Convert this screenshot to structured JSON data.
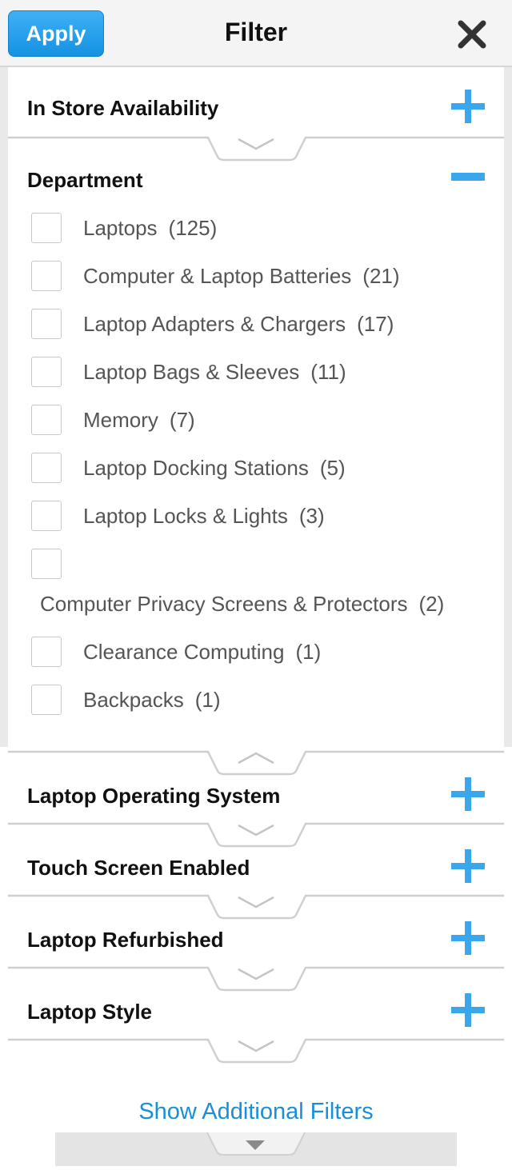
{
  "header": {
    "apply_label": "Apply",
    "title": "Filter"
  },
  "sections": {
    "in_store": "In Store Availability",
    "department": "Department",
    "os": "Laptop Operating System",
    "touch": "Touch Screen Enabled",
    "refurb": "Laptop Refurbished",
    "style": "Laptop Style"
  },
  "department_items": [
    {
      "label": "Laptops",
      "count": "(125)"
    },
    {
      "label": "Computer & Laptop Batteries",
      "count": "(21)"
    },
    {
      "label": "Laptop Adapters & Chargers",
      "count": "(17)"
    },
    {
      "label": "Laptop Bags & Sleeves",
      "count": "(11)"
    },
    {
      "label": "Memory",
      "count": "(7)"
    },
    {
      "label": "Laptop Docking Stations",
      "count": "(5)"
    },
    {
      "label": "Laptop Locks & Lights",
      "count": "(3)"
    },
    {
      "label": "Computer Privacy Screens & Protectors",
      "count": "(2)"
    },
    {
      "label": "Clearance Computing",
      "count": "(1)"
    },
    {
      "label": "Backpacks",
      "count": "(1)"
    }
  ],
  "footer": {
    "show_more_label": "Show Additional Filters"
  },
  "colors": {
    "accent": "#1592e3",
    "icon_blue": "#3aa6ec",
    "link": "#1a8fd8"
  }
}
